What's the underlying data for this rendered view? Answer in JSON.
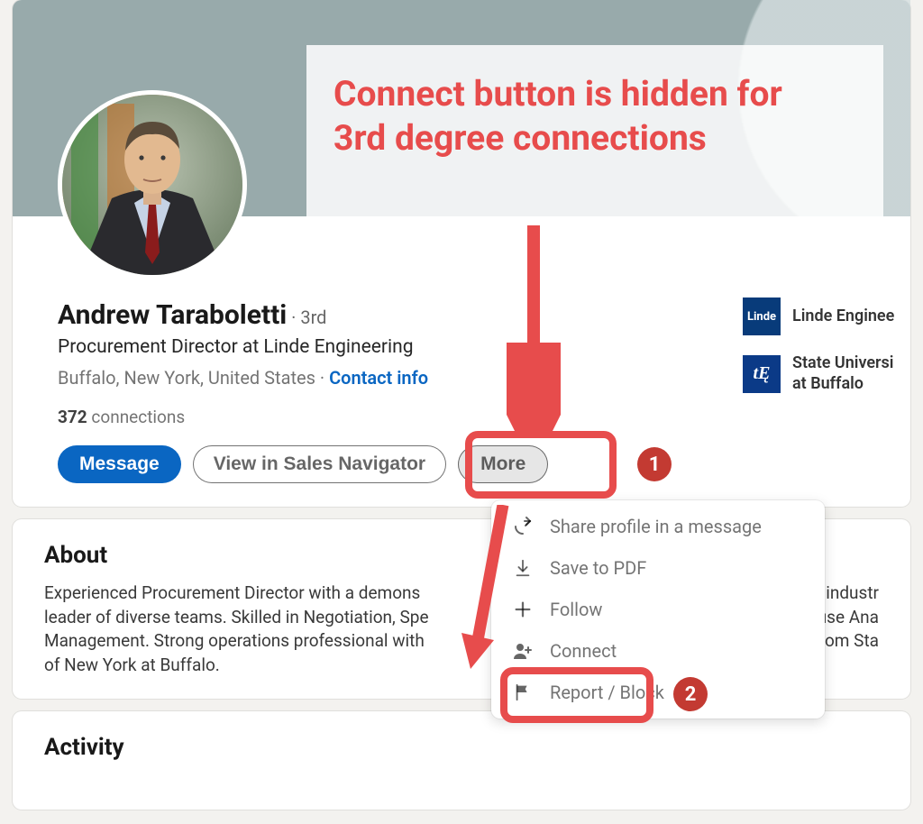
{
  "annotation": {
    "headline": "Connect button is hidden for 3rd degree connections",
    "step1": "1",
    "step2": "2"
  },
  "profile": {
    "name": "Andrew Taraboletti",
    "degree_sep": " · ",
    "degree": "3rd",
    "headline": "Procurement Director at Linde Engineering",
    "location": "Buffalo, New York, United States",
    "sep": " · ",
    "contact_info": "Contact info",
    "connections_count": "372",
    "connections_label": " connections"
  },
  "buttons": {
    "message": "Message",
    "sales_nav": "View in Sales Navigator",
    "more": "More"
  },
  "orgs": {
    "company_label": "Linde Enginee",
    "school_label": "State Universi",
    "school_label2": "at Buffalo",
    "linde_mark": "Linde",
    "ub_mark": "tĘ"
  },
  "dropdown": {
    "share": "Share profile in a message",
    "save_pdf": "Save to PDF",
    "follow": "Follow",
    "connect": "Connect",
    "report": "Report / Block"
  },
  "about": {
    "title": "About",
    "text_line1": "Experienced Procurement Director with a demons",
    "text_line1b": "cals industr",
    "text_line2": "leader of diverse teams. Skilled in Negotiation, Spe",
    "text_line2b": "t Cause Ana",
    "text_line3": "Management. Strong operations professional with",
    "text_line3b": "ing from Sta",
    "text_line4": "of New York at Buffalo."
  },
  "activity": {
    "title": "Activity"
  }
}
